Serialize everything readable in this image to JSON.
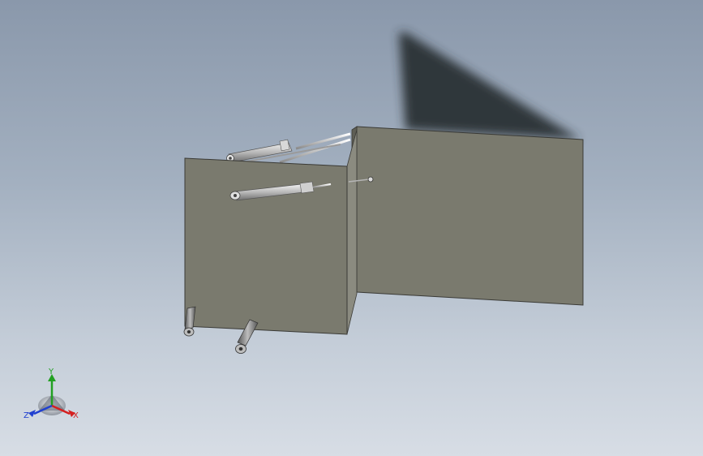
{
  "viewport": {
    "background_top": "#8a98ab",
    "background_bottom": "#d7dde5"
  },
  "model": {
    "panel_color": "#7a7a6e",
    "panel_edge_color": "#3a3a36",
    "shadow_color": "#2c3036",
    "cylinder_color": "#c9c9c9"
  },
  "triad": {
    "x_label": "X",
    "y_label": "Y",
    "z_label": "Z",
    "x_color": "#d42020",
    "y_color": "#22a022",
    "z_color": "#2040d0"
  }
}
